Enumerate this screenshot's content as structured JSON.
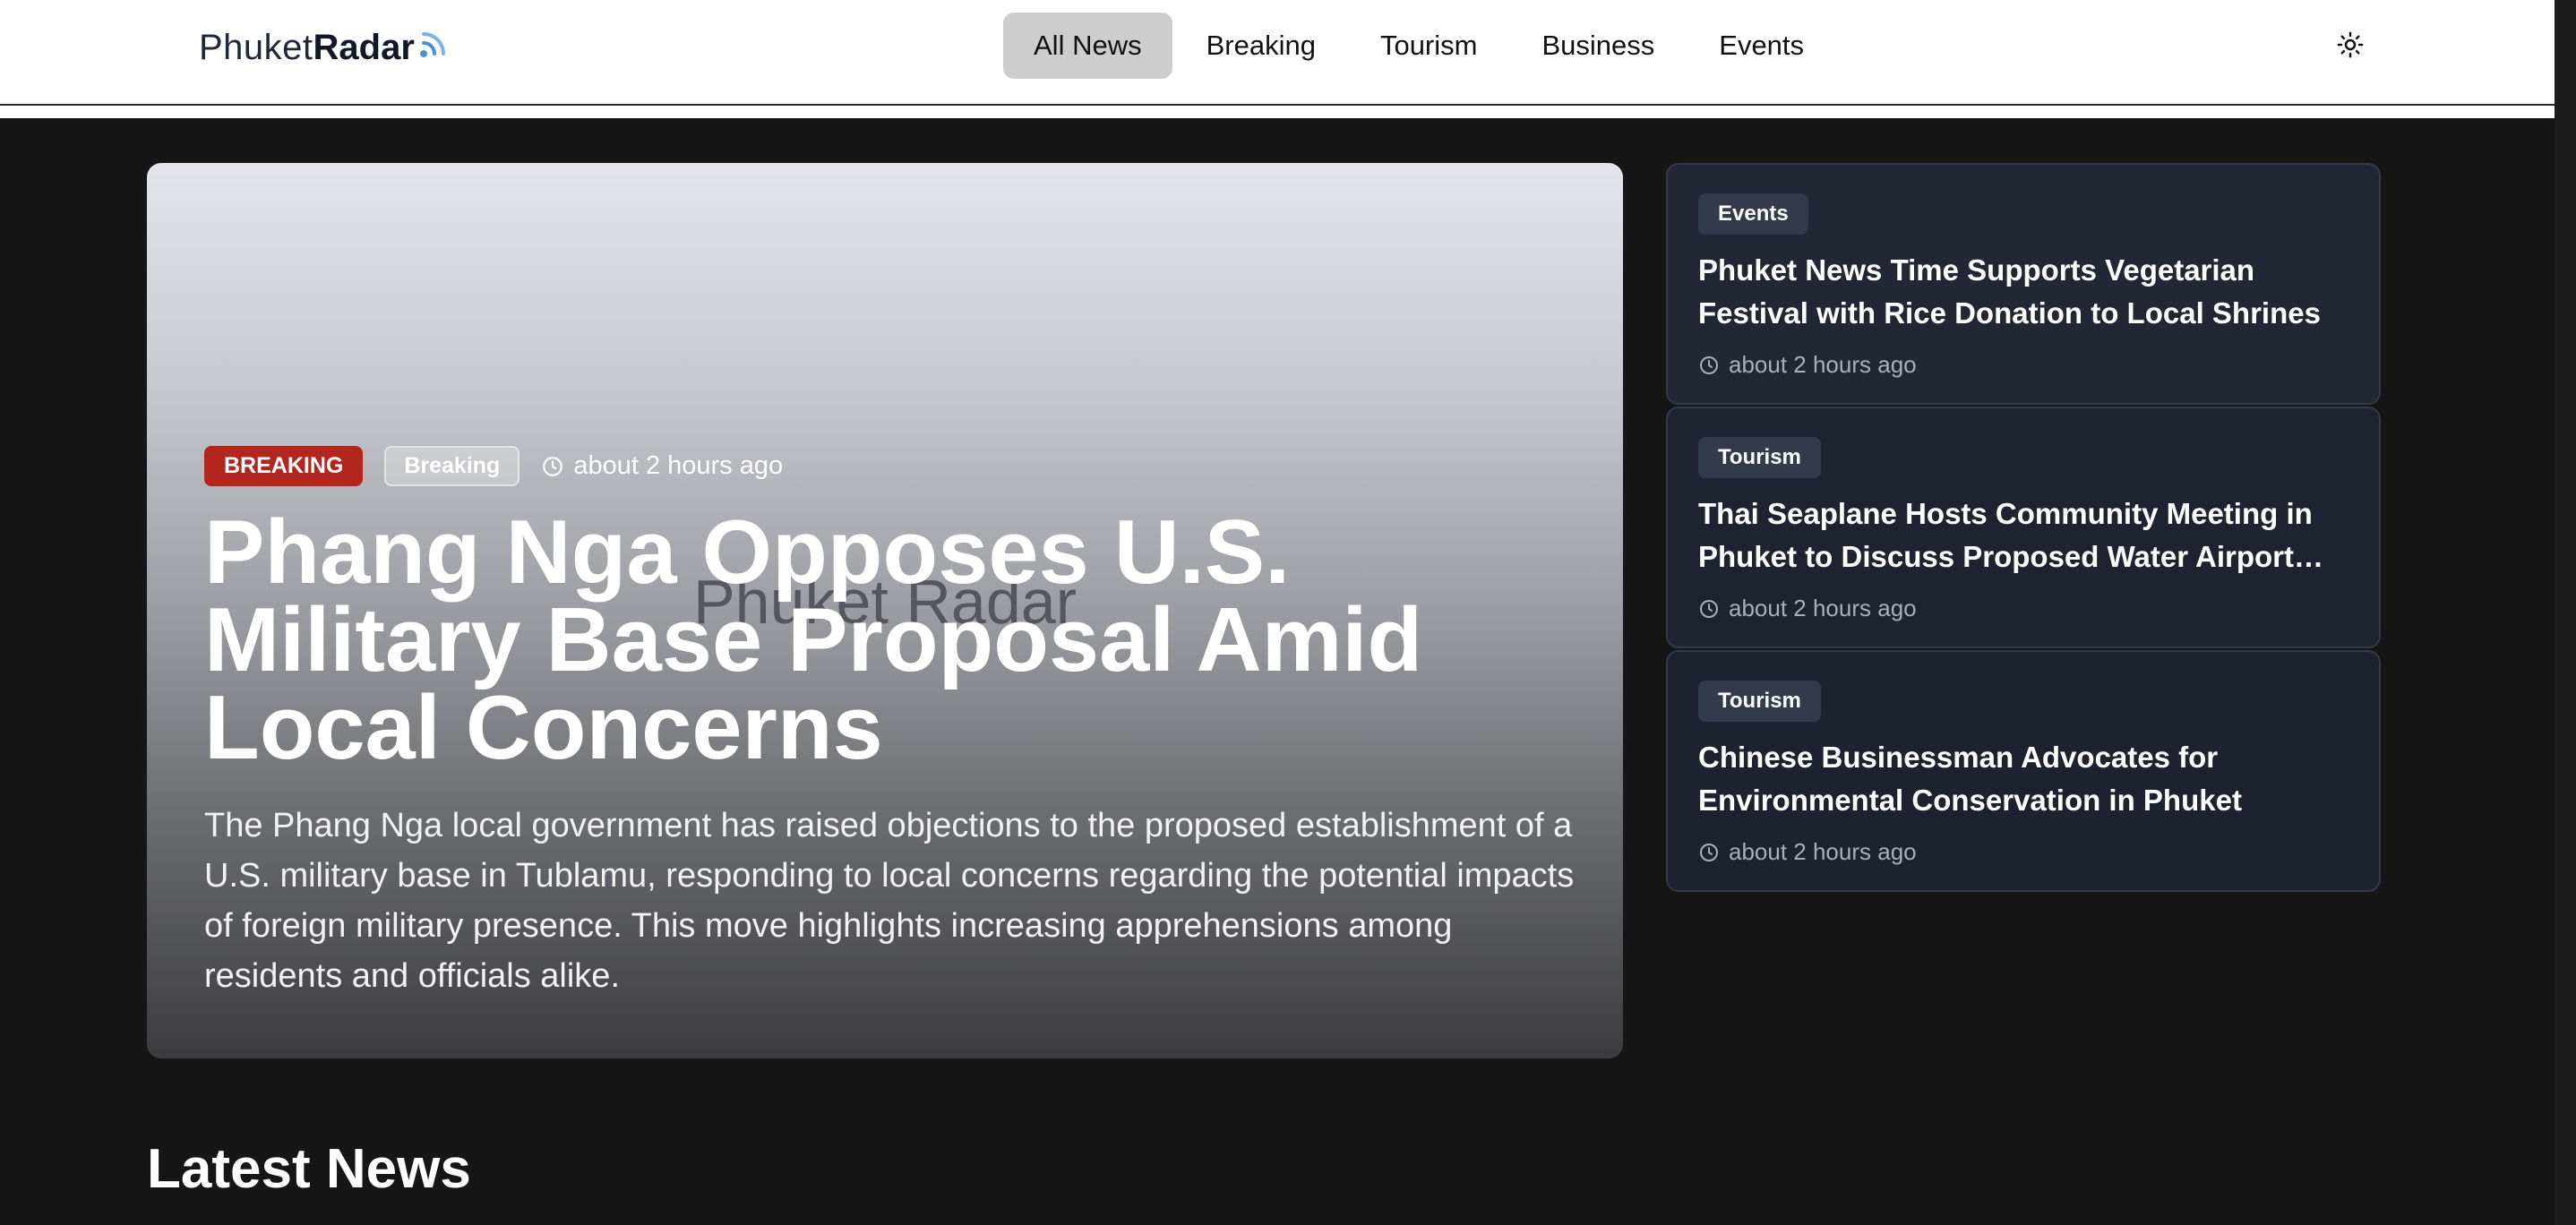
{
  "brand": {
    "name_light": "Phuket",
    "name_bold": "Radar",
    "text_color": "#1f2937",
    "icon_color": "#4a90d9",
    "icon": "radar-wave-icon"
  },
  "nav": {
    "items": [
      {
        "label": "All News",
        "active": true
      },
      {
        "label": "Breaking",
        "active": false
      },
      {
        "label": "Tourism",
        "active": false
      },
      {
        "label": "Business",
        "active": false
      },
      {
        "label": "Events",
        "active": false
      }
    ],
    "theme_toggle_icon": "sun-icon"
  },
  "hero": {
    "watermark": "Phuket Radar",
    "badge_primary": "BREAKING",
    "badge_category": "Breaking",
    "time": "about 2 hours ago",
    "title": "Phang Nga Opposes U.S. Military Base Proposal Amid Local Concerns",
    "summary": "The Phang Nga local government has raised objections to the proposed establishment of a U.S. military base in Tublamu, responding to local concerns regarding the potential impacts of foreign military presence. This move highlights increasing apprehensions among residents and officials alike."
  },
  "side_articles": [
    {
      "category": "Events",
      "title": "Phuket News Time Supports Vegetarian Festival with Rice Donation to Local Shrines",
      "time": "about 2 hours ago"
    },
    {
      "category": "Tourism",
      "title": "Thai Seaplane Hosts Community Meeting in Phuket to Discuss Proposed Water Airport Development",
      "time": "about 2 hours ago"
    },
    {
      "category": "Tourism",
      "title": "Chinese Businessman Advocates for Environmental Conservation in Phuket",
      "time": "about 2 hours ago"
    }
  ],
  "latest": {
    "title": "Latest News"
  },
  "colors": {
    "page_bg": "#161616",
    "header_bg": "#ffffff",
    "breaking_red": "#b3261e",
    "card_bg": "#232735",
    "nav_active_bg": "#cdcdcd"
  }
}
